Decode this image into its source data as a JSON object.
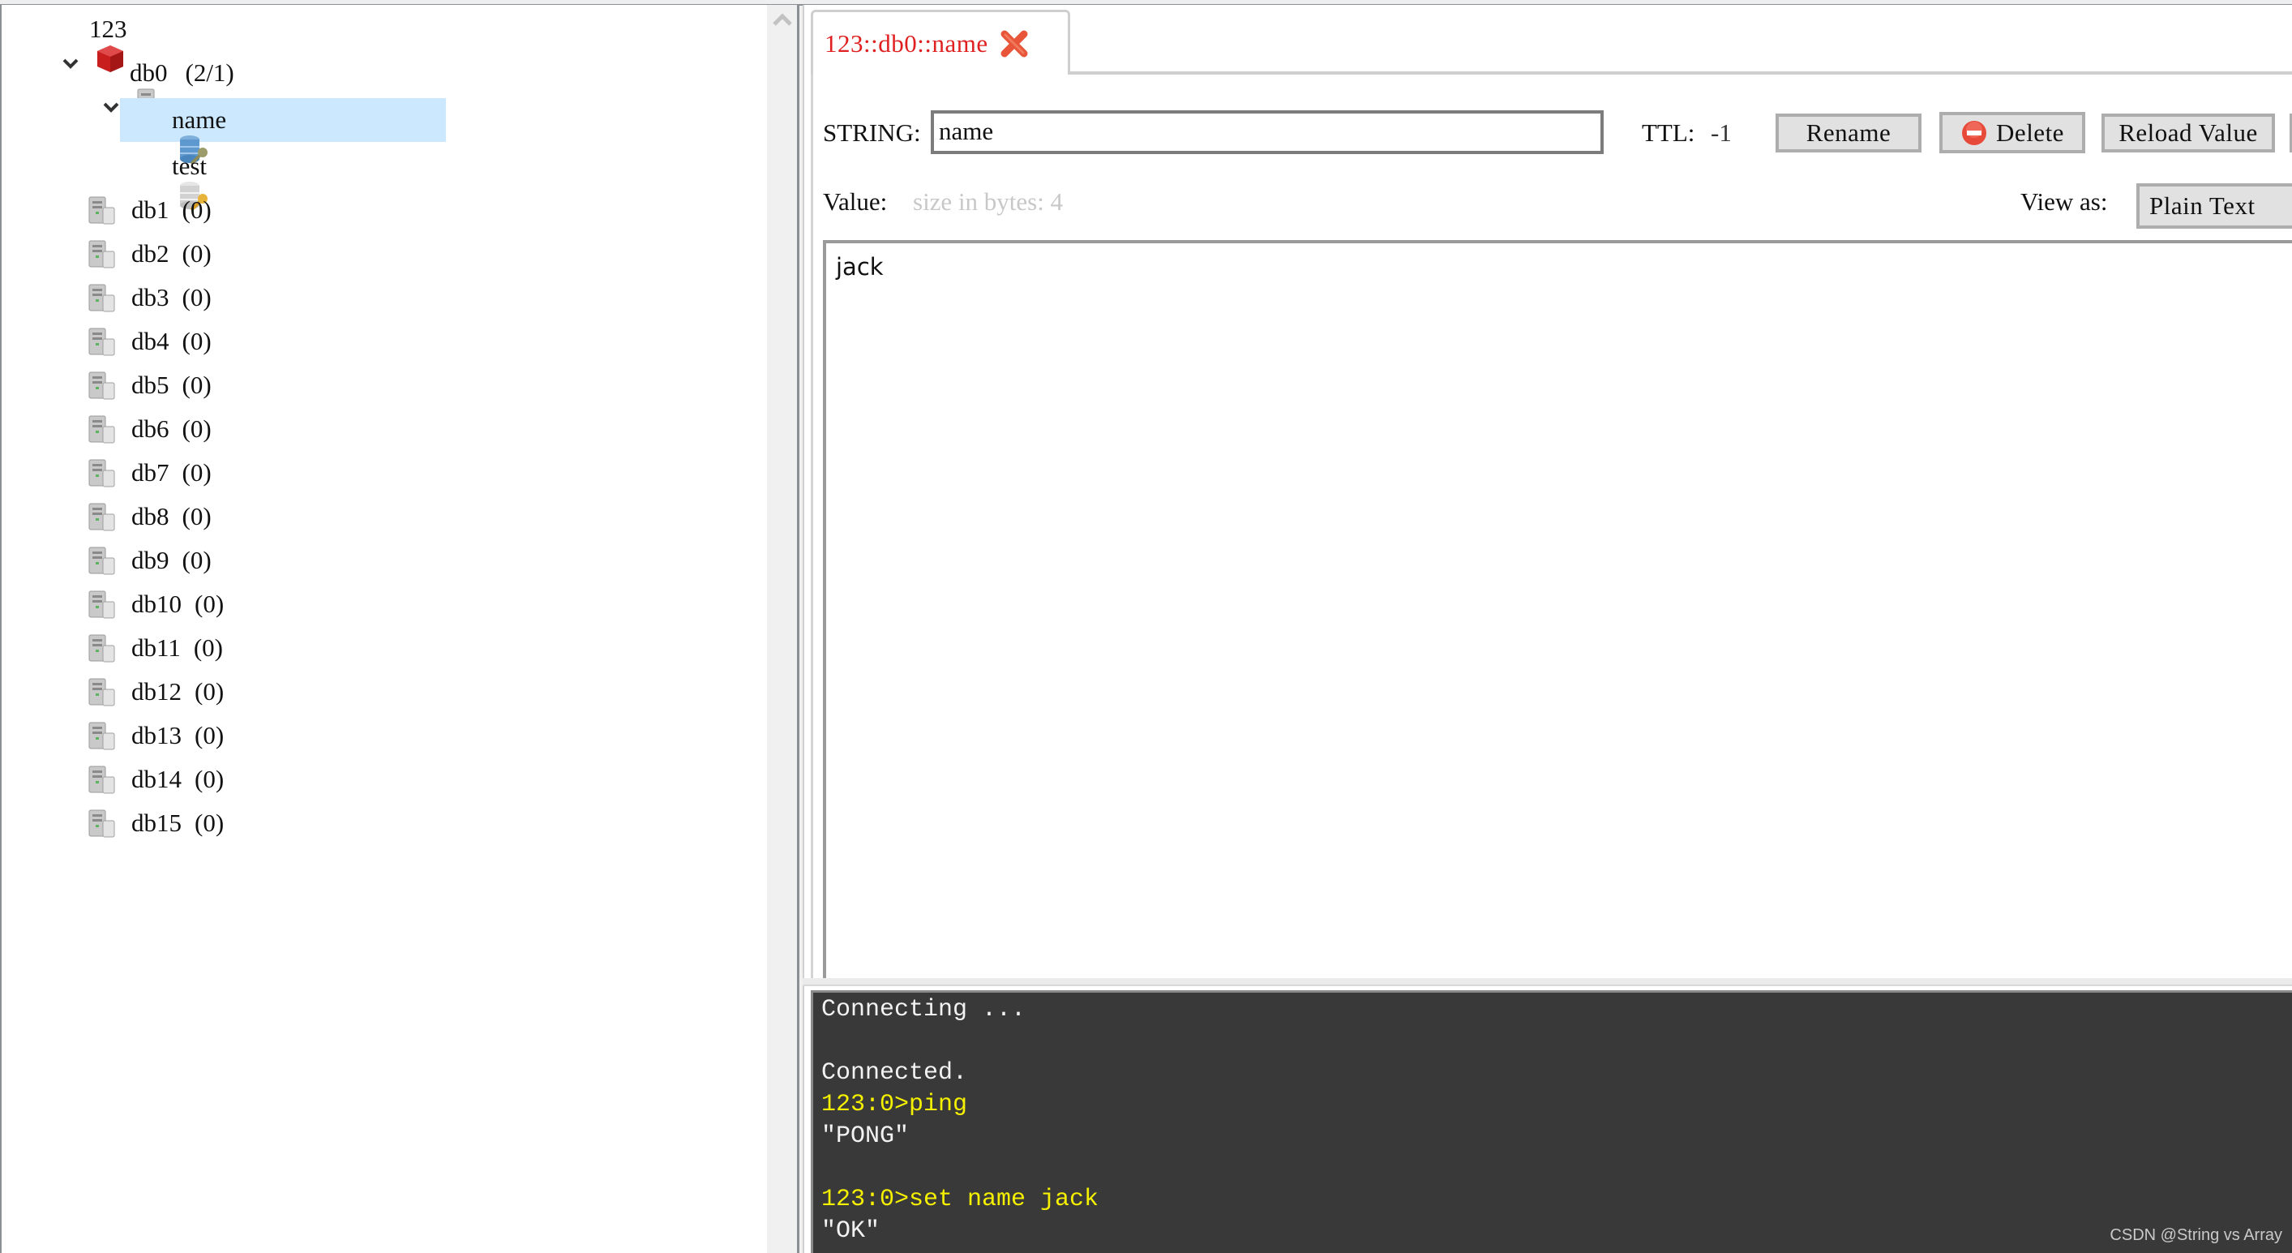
{
  "tree": {
    "connection": {
      "label": "123",
      "expanded": true
    },
    "databases": [
      {
        "label": "db0",
        "count": "(2/1)",
        "expanded": true,
        "keys": [
          {
            "label": "name",
            "selected": true
          },
          {
            "label": "test",
            "selected": false
          }
        ]
      },
      {
        "label": "db1",
        "count": "(0)"
      },
      {
        "label": "db2",
        "count": "(0)"
      },
      {
        "label": "db3",
        "count": "(0)"
      },
      {
        "label": "db4",
        "count": "(0)"
      },
      {
        "label": "db5",
        "count": "(0)"
      },
      {
        "label": "db6",
        "count": "(0)"
      },
      {
        "label": "db7",
        "count": "(0)"
      },
      {
        "label": "db8",
        "count": "(0)"
      },
      {
        "label": "db9",
        "count": "(0)"
      },
      {
        "label": "db10",
        "count": "(0)"
      },
      {
        "label": "db11",
        "count": "(0)"
      },
      {
        "label": "db12",
        "count": "(0)"
      },
      {
        "label": "db13",
        "count": "(0)"
      },
      {
        "label": "db14",
        "count": "(0)"
      },
      {
        "label": "db15",
        "count": "(0)"
      }
    ]
  },
  "tab": {
    "label": "123::db0::name",
    "close_icon": "close-x-icon"
  },
  "key_editor": {
    "type_label": "STRING:",
    "key_value": "name",
    "ttl_label": "TTL:",
    "ttl_value": "-1",
    "rename_label": "Rename",
    "delete_label": "Delete",
    "reload_label": "Reload Value",
    "value_label": "Value:",
    "value_hint": "size in bytes: 4",
    "view_as_label": "View as:",
    "view_as_selected": "Plain Text",
    "value_text": "jack"
  },
  "console": {
    "lines": [
      {
        "text": "Connecting ...",
        "kind": "output"
      },
      {
        "text": "",
        "kind": "output"
      },
      {
        "text": "Connected.",
        "kind": "output"
      },
      {
        "text": "123:0>ping",
        "kind": "command"
      },
      {
        "text": "\"PONG\"",
        "kind": "output"
      },
      {
        "text": "",
        "kind": "output"
      },
      {
        "text": "123:0>set name jack",
        "kind": "command"
      },
      {
        "text": "\"OK\"",
        "kind": "output"
      }
    ]
  },
  "watermark": "CSDN @String vs Array",
  "colors": {
    "tab_label": "#e02020",
    "selection": "#cce8ff",
    "console_bg": "#393939",
    "console_command": "#f5f000"
  }
}
